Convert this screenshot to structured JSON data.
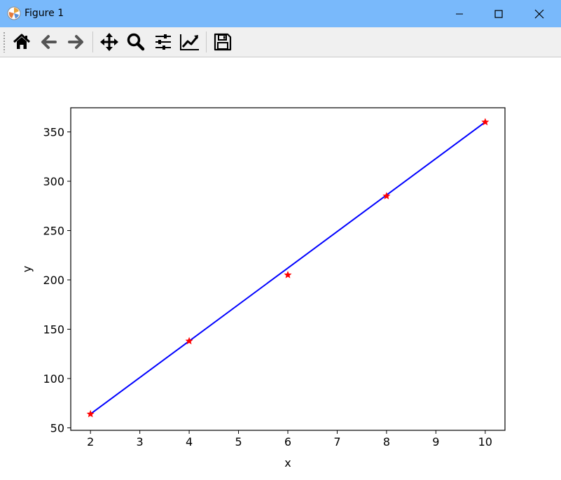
{
  "window": {
    "title": "Figure 1"
  },
  "toolbar": {
    "buttons": [
      {
        "name": "home",
        "icon": "home-icon"
      },
      {
        "name": "back",
        "icon": "arrow-left-icon"
      },
      {
        "name": "forward",
        "icon": "arrow-right-icon"
      },
      {
        "name": "pan",
        "icon": "move-icon"
      },
      {
        "name": "zoom",
        "icon": "magnifier-icon"
      },
      {
        "name": "configure-subplots",
        "icon": "sliders-icon"
      },
      {
        "name": "edit-axis",
        "icon": "line-chart-icon"
      },
      {
        "name": "save",
        "icon": "floppy-disk-icon"
      }
    ]
  },
  "chart_data": {
    "type": "line",
    "xlabel": "x",
    "ylabel": "y",
    "xlim": [
      1.6,
      10.4
    ],
    "ylim": [
      47.5,
      374.5
    ],
    "xticks": [
      2,
      3,
      4,
      5,
      6,
      7,
      8,
      9,
      10
    ],
    "yticks": [
      50,
      100,
      150,
      200,
      250,
      300,
      350
    ],
    "grid": false,
    "series": [
      {
        "style": "line",
        "color": "#0000ff",
        "x": [
          2,
          10
        ],
        "y": [
          64,
          360
        ]
      },
      {
        "style": "markers",
        "marker": "star",
        "color": "#ff0000",
        "x": [
          2,
          4,
          6,
          8,
          10
        ],
        "y": [
          64,
          138,
          205,
          285,
          360
        ]
      }
    ]
  }
}
